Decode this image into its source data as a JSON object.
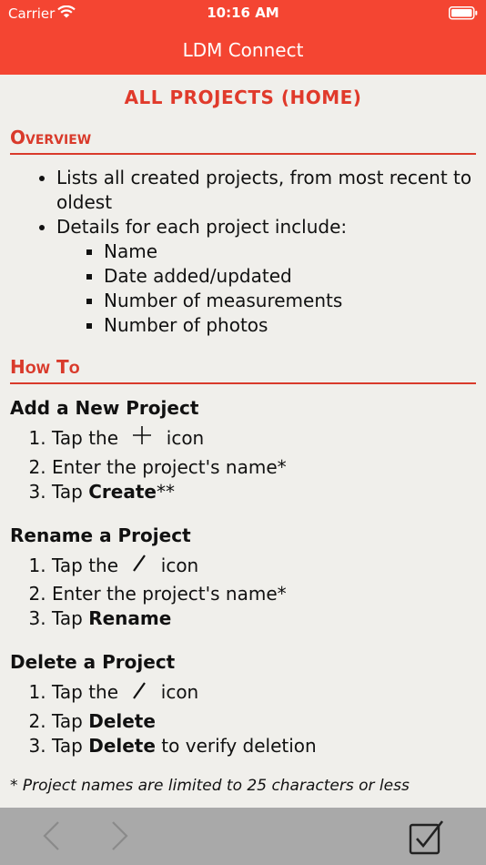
{
  "status_bar": {
    "carrier": "Carrier",
    "time": "10:16 AM"
  },
  "nav": {
    "title": "LDM Connect"
  },
  "page": {
    "title": "ALL PROJECTS (HOME)",
    "overview": {
      "heading": "Overview",
      "bullets": [
        "Lists all created projects, from most recent to oldest",
        "Details for each project include:"
      ],
      "details": [
        "Name",
        "Date added/updated",
        "Number of measurements",
        "Number of photos"
      ]
    },
    "howto": {
      "heading": "How To",
      "add": {
        "title": "Add a New Project",
        "step1_pre": "Tap the",
        "step1_post": "icon",
        "step2": "Enter the project's name*",
        "step3_pre": "Tap",
        "step3_bold": "Create",
        "step3_post": "**"
      },
      "rename": {
        "title": "Rename a Project",
        "step1_pre": "Tap the",
        "step1_post": "icon",
        "step2": "Enter the project's name*",
        "step3_pre": "Tap",
        "step3_bold": "Rename"
      },
      "delete": {
        "title": "Delete a Project",
        "step1_pre": "Tap the",
        "step1_post": "icon",
        "step2_pre": "Tap",
        "step2_bold": "Delete",
        "step3_pre": "Tap",
        "step3_bold": "Delete",
        "step3_post": "to verify deletion"
      },
      "footnote": "* Project names are limited to 25 characters or less"
    }
  },
  "toolbar": {
    "back_icon": "chevron-left-icon",
    "forward_icon": "chevron-right-icon",
    "done_icon": "checkbox-icon"
  },
  "colors": {
    "accent": "#f44532",
    "heading": "#d93a2b",
    "background": "#f0efeb",
    "toolbar": "#a9a9a9"
  }
}
